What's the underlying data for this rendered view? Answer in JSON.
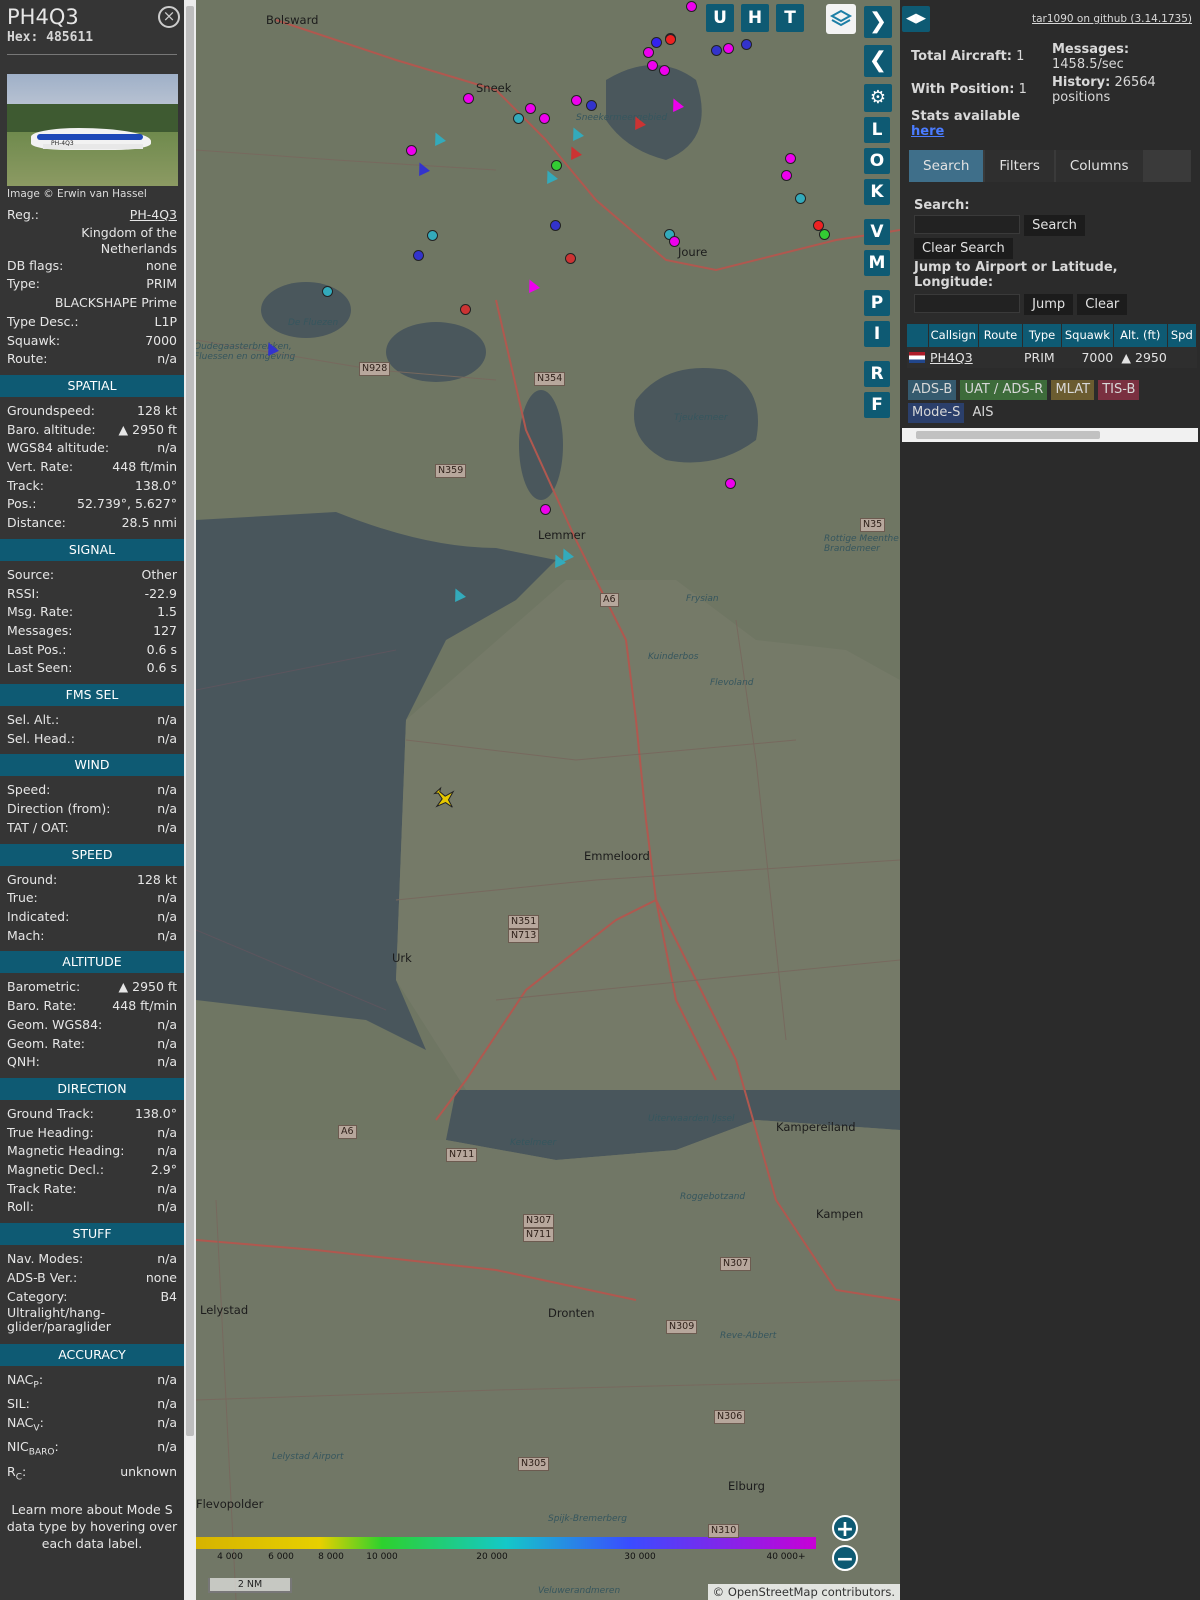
{
  "info": {
    "callsign": "PH4Q3",
    "hex_label": "Hex:",
    "hex": "485611",
    "close_icon": "close-icon",
    "photo_credit": "Image © Erwin van Hassel",
    "reg_label": "Reg.:",
    "reg": "PH-4Q3",
    "country": "Kingdom of the Netherlands",
    "rows_top": [
      {
        "label": "DB flags:",
        "value": "none"
      },
      {
        "label": "Type:",
        "value": "PRIM"
      }
    ],
    "type_name": "BLACKSHAPE Prime",
    "rows_top2": [
      {
        "label": "Type Desc.:",
        "value": "L1P"
      },
      {
        "label": "Squawk:",
        "value": "7000"
      },
      {
        "label": "Route:",
        "value": "n/a"
      }
    ],
    "sections": [
      {
        "title": "SPATIAL",
        "rows": [
          {
            "label": "Groundspeed:",
            "value": "128 kt"
          },
          {
            "label": "Baro. altitude:",
            "value": "▲ 2950 ft"
          },
          {
            "label": "WGS84 altitude:",
            "value": "n/a"
          },
          {
            "label": "Vert. Rate:",
            "value": "448 ft/min"
          },
          {
            "label": "Track:",
            "value": "138.0°"
          },
          {
            "label": "Pos.:",
            "value": "52.739°, 5.627°"
          },
          {
            "label": "Distance:",
            "value": "28.5 nmi"
          }
        ]
      },
      {
        "title": "SIGNAL",
        "rows": [
          {
            "label": "Source:",
            "value": "Other"
          },
          {
            "label": "RSSI:",
            "value": "-22.9"
          },
          {
            "label": "Msg. Rate:",
            "value": "1.5"
          },
          {
            "label": "Messages:",
            "value": "127"
          },
          {
            "label": "Last Pos.:",
            "value": "0.6 s"
          },
          {
            "label": "Last Seen:",
            "value": "0.6 s"
          }
        ]
      },
      {
        "title": "FMS SEL",
        "rows": [
          {
            "label": "Sel. Alt.:",
            "value": "n/a"
          },
          {
            "label": "Sel. Head.:",
            "value": "n/a"
          }
        ]
      },
      {
        "title": "WIND",
        "rows": [
          {
            "label": "Speed:",
            "value": "n/a"
          },
          {
            "label": "Direction (from):",
            "value": "n/a"
          },
          {
            "label": "TAT / OAT:",
            "value": "n/a"
          }
        ]
      },
      {
        "title": "SPEED",
        "rows": [
          {
            "label": "Ground:",
            "value": "128 kt"
          },
          {
            "label": "True:",
            "value": "n/a"
          },
          {
            "label": "Indicated:",
            "value": "n/a"
          },
          {
            "label": "Mach:",
            "value": "n/a"
          }
        ]
      },
      {
        "title": "ALTITUDE",
        "rows": [
          {
            "label": "Barometric:",
            "value": "▲ 2950 ft"
          },
          {
            "label": "Baro. Rate:",
            "value": "448 ft/min"
          },
          {
            "label": "Geom. WGS84:",
            "value": "n/a"
          },
          {
            "label": "Geom. Rate:",
            "value": "n/a"
          },
          {
            "label": "QNH:",
            "value": "n/a"
          }
        ]
      },
      {
        "title": "DIRECTION",
        "rows": [
          {
            "label": "Ground Track:",
            "value": "138.0°"
          },
          {
            "label": "True Heading:",
            "value": "n/a"
          },
          {
            "label": "Magnetic Heading:",
            "value": "n/a"
          },
          {
            "label": "Magnetic Decl.:",
            "value": "2.9°"
          },
          {
            "label": "Track Rate:",
            "value": "n/a"
          },
          {
            "label": "Roll:",
            "value": "n/a"
          }
        ]
      },
      {
        "title": "STUFF",
        "rows": [
          {
            "label": "Nav. Modes:",
            "value": "n/a"
          },
          {
            "label": "ADS-B Ver.:",
            "value": "none"
          },
          {
            "label": "Category:",
            "value": "B4"
          }
        ]
      }
    ],
    "category_desc": "Ultralight/hang-glider/paraglider",
    "accuracy": {
      "title": "ACCURACY",
      "rows": [
        {
          "label": "NAC",
          "sub": "P",
          "value": "n/a"
        },
        {
          "label": "SIL:",
          "sub": "",
          "value": "n/a"
        },
        {
          "label": "NAC",
          "sub": "V",
          "value": "n/a"
        },
        {
          "label": "NIC",
          "sub": "BARO",
          "value": "n/a"
        },
        {
          "label": "R",
          "sub": "C",
          "value": "unknown"
        }
      ]
    },
    "footer": "Learn more about Mode S data type by hovering over each data label."
  },
  "map": {
    "towns": [
      {
        "name": "Bolsward",
        "cls": "map-town"
      },
      {
        "name": "Sneek",
        "cls": "map-town"
      },
      {
        "name": "Joure",
        "cls": "map-town"
      },
      {
        "name": "Lemmer",
        "cls": "map-town"
      },
      {
        "name": "Emmeloord",
        "cls": "map-town"
      },
      {
        "name": "Urk",
        "cls": "map-town"
      },
      {
        "name": "Lelystad",
        "cls": "map-town"
      },
      {
        "name": "Dronten",
        "cls": "map-town"
      },
      {
        "name": "Kampen",
        "cls": "map-town"
      },
      {
        "name": "Elburg",
        "cls": "map-town"
      },
      {
        "name": "Kampereiland",
        "cls": "map-town"
      },
      {
        "name": "Flevopolder",
        "cls": "map-town"
      },
      {
        "name": "Oudegaasterbrekken, Fluessen en omgeving",
        "cls": "map-water"
      },
      {
        "name": "Sneekermeergebied",
        "cls": "map-water"
      },
      {
        "name": "Tjeukemeer",
        "cls": "map-water"
      },
      {
        "name": "Kuinderbos",
        "cls": "map-water"
      },
      {
        "name": "Flevoland",
        "cls": "map-water"
      },
      {
        "name": "Ketelmeer",
        "cls": "map-water"
      },
      {
        "name": "Uiterwaarden IJssel",
        "cls": "map-water"
      },
      {
        "name": "Roggebotzand",
        "cls": "map-water"
      },
      {
        "name": "Reve-Abbert",
        "cls": "map-water"
      },
      {
        "name": "Lelystad Airport",
        "cls": "map-water"
      },
      {
        "name": "Rottige Meenthe & Brandemeer",
        "cls": "map-water"
      },
      {
        "name": "De Fluezen",
        "cls": "map-water"
      },
      {
        "name": "Frysian",
        "cls": "map-water"
      },
      {
        "name": "Spijk-Bremerberg",
        "cls": "map-water"
      },
      {
        "name": "Veluwerandmeren",
        "cls": "map-water"
      }
    ],
    "shields": [
      "N928",
      "N354",
      "N359",
      "A6",
      "N351",
      "N713",
      "A6",
      "N711",
      "N307",
      "N711",
      "N307",
      "N309",
      "N306",
      "N305",
      "N310",
      "N35"
    ],
    "controls": {
      "view_buttons": [
        "U",
        "H",
        "T"
      ],
      "side_buttons": [
        "L",
        "O",
        "K",
        "V",
        "M",
        "P",
        "I",
        "R",
        "F"
      ],
      "next_icon": "chevron-right-icon",
      "prev_icon": "chevron-left-icon",
      "settings_icon": "gear-icon",
      "layers_icon": "layers-icon"
    },
    "altitude_legend": [
      "4 000",
      "6 000",
      "8 000",
      "10 000",
      "20 000",
      "30 000",
      "40 000+"
    ],
    "scale_label": "2 NM",
    "attribution_prefix": "© ",
    "attribution_link": "OpenStreetMap",
    "attribution_suffix": " contributors.",
    "zoom_in": "+",
    "zoom_out": "−",
    "selected_aircraft_icon": "selected-plane-icon"
  },
  "right": {
    "github_text": "tar1090 on github (3.14.1735)",
    "stats": {
      "total_label": "Total Aircraft:",
      "total": "1",
      "with_pos_label": "With Position:",
      "with_pos": "1",
      "stats_text": "Stats available",
      "stats_link": "here",
      "messages_label": "Messages:",
      "messages": "1458.5/sec",
      "history_label": "History:",
      "history": "26564 positions"
    },
    "tabs": [
      "Search",
      "Filters",
      "Columns"
    ],
    "search_label": "Search:",
    "search_button": "Search",
    "clear_search_button": "Clear Search",
    "jump_label": "Jump to Airport or Latitude, Longitude:",
    "jump_button": "Jump",
    "clear_button": "Clear",
    "columns": [
      "Callsign",
      "Route",
      "Type",
      "Squawk",
      "Alt. (ft)",
      "Spd"
    ],
    "rows": [
      {
        "callsign": "PH4Q3",
        "route": "",
        "type": "PRIM",
        "squawk": "7000",
        "alt": "▲ 2950",
        "spd": ""
      }
    ],
    "legend": [
      {
        "label": "ADS-B",
        "bg": "#355a6e"
      },
      {
        "label": "UAT / ADS-R",
        "bg": "#3d6b3a"
      },
      {
        "label": "MLAT",
        "bg": "#6b5c30"
      },
      {
        "label": "TIS-B",
        "bg": "#7a3040"
      },
      {
        "label": "Mode-S",
        "bg": "#2b3f6b"
      },
      {
        "label": "AIS",
        "bg": "transparent"
      }
    ]
  }
}
